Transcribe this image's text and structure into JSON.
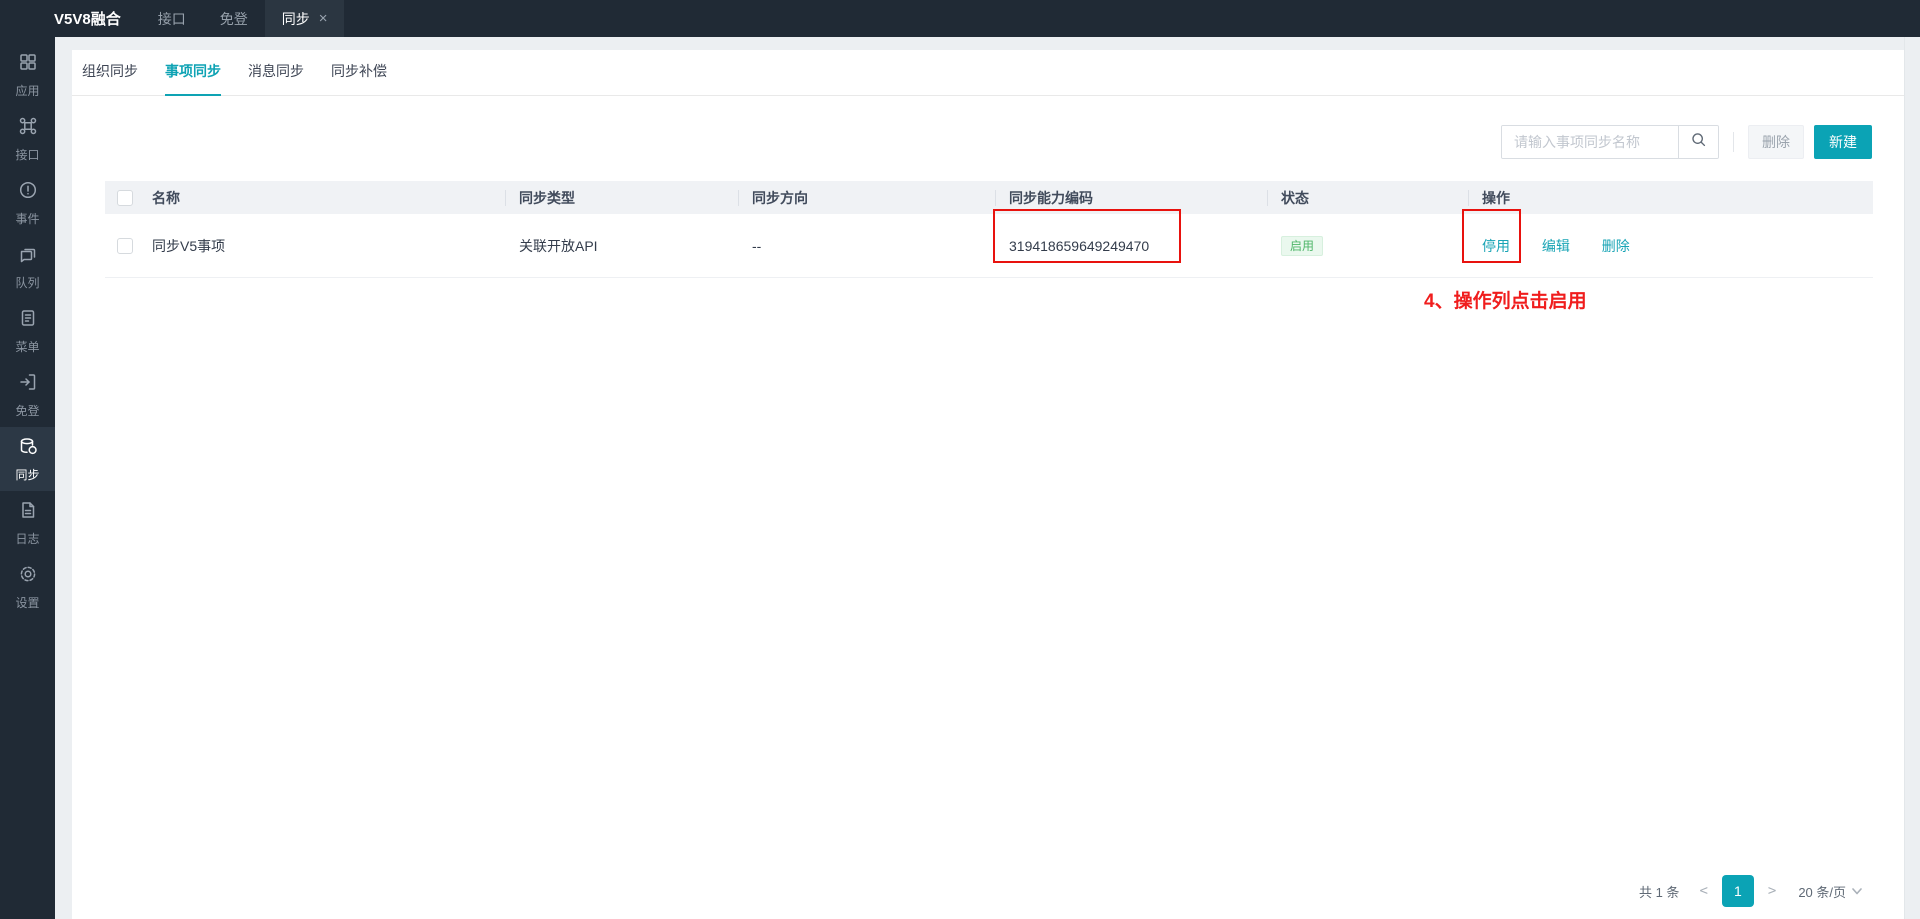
{
  "topbar": {
    "title": "V5V8融合",
    "tabs": [
      {
        "label": "接口",
        "active": false
      },
      {
        "label": "免登",
        "active": false
      },
      {
        "label": "同步",
        "active": true,
        "closable": true
      }
    ],
    "close_icon": "×"
  },
  "sidebar": {
    "items": [
      {
        "label": "应用",
        "icon": "apps-icon",
        "active": false
      },
      {
        "label": "接口",
        "icon": "api-icon",
        "active": false
      },
      {
        "label": "事件",
        "icon": "event-icon",
        "active": false
      },
      {
        "label": "队列",
        "icon": "queue-icon",
        "active": false
      },
      {
        "label": "菜单",
        "icon": "menu-icon",
        "active": false
      },
      {
        "label": "免登",
        "icon": "login-icon",
        "active": false
      },
      {
        "label": "同步",
        "icon": "sync-icon",
        "active": true
      },
      {
        "label": "日志",
        "icon": "log-icon",
        "active": false
      },
      {
        "label": "设置",
        "icon": "settings-icon",
        "active": false
      }
    ]
  },
  "content": {
    "tabs": [
      {
        "label": "组织同步",
        "active": false
      },
      {
        "label": "事项同步",
        "active": true
      },
      {
        "label": "消息同步",
        "active": false
      },
      {
        "label": "同步补偿",
        "active": false
      }
    ],
    "toolbar": {
      "search_placeholder": "请输入事项同步名称",
      "search_icon": "search-icon",
      "delete_label": "删除",
      "create_label": "新建"
    },
    "table": {
      "columns": [
        "名称",
        "同步类型",
        "同步方向",
        "同步能力编码",
        "状态",
        "操作"
      ],
      "rows": [
        {
          "name": "同步V5事项",
          "sync_type": "关联开放API",
          "direction": "--",
          "code": "319418659649249470",
          "status": "启用",
          "actions": [
            "停用",
            "编辑",
            "删除"
          ]
        }
      ]
    },
    "annotation": "4、操作列点击启用",
    "pagination": {
      "total": "共 1 条",
      "prev": "<",
      "current_page": "1",
      "next": ">",
      "page_size": "20 条/页",
      "chevron_icon": "chevron-down-icon"
    }
  },
  "colors": {
    "topbar_bg": "#202a35",
    "sidebar_active_bg": "#2c3845",
    "accent_teal": "#0ba3b5",
    "status_green": "#4fb669",
    "status_green_bg": "#eaf8ee",
    "highlight_red": "#e8120e",
    "table_header_bg": "#f0f2f5"
  }
}
